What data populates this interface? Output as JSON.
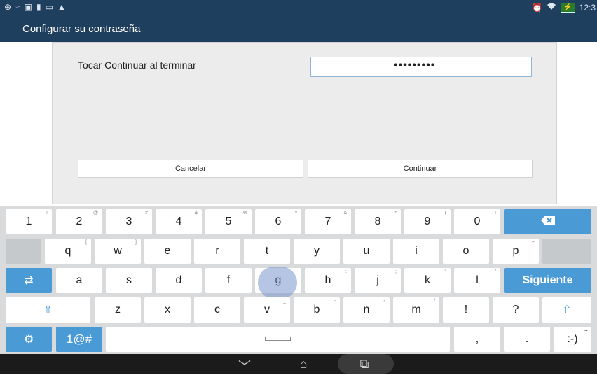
{
  "status_bar": {
    "left_icons": [
      "⊕",
      "≈",
      "▣",
      "▮",
      "▭",
      "▲"
    ],
    "right_icons": [
      "⏰",
      "wifi"
    ],
    "time": "12:3",
    "battery_label": "⚡"
  },
  "app": {
    "title": "Configurar su contraseña"
  },
  "form": {
    "prompt": "Tocar Continuar al terminar",
    "password_masked": "•••••••••",
    "cancel_label": "Cancelar",
    "continue_label": "Continuar"
  },
  "keyboard": {
    "row1": [
      {
        "label": "1",
        "hint": "!"
      },
      {
        "label": "2",
        "hint": "@"
      },
      {
        "label": "3",
        "hint": "#"
      },
      {
        "label": "4",
        "hint": "$"
      },
      {
        "label": "5",
        "hint": "%"
      },
      {
        "label": "6",
        "hint": "^"
      },
      {
        "label": "7",
        "hint": "&"
      },
      {
        "label": "8",
        "hint": "*"
      },
      {
        "label": "9",
        "hint": "("
      },
      {
        "label": "0",
        "hint": ")"
      }
    ],
    "backspace_icon": "backspace-icon",
    "row2": [
      {
        "label": "q",
        "hint": "["
      },
      {
        "label": "w",
        "hint": "]"
      },
      {
        "label": "e",
        "hint": ""
      },
      {
        "label": "r",
        "hint": ""
      },
      {
        "label": "t",
        "hint": ""
      },
      {
        "label": "y",
        "hint": ""
      },
      {
        "label": "u",
        "hint": ""
      },
      {
        "label": "i",
        "hint": ""
      },
      {
        "label": "o",
        "hint": ""
      },
      {
        "label": "p",
        "hint": "+"
      }
    ],
    "row3": [
      {
        "label": "a",
        "hint": ""
      },
      {
        "label": "s",
        "hint": ""
      },
      {
        "label": "d",
        "hint": ""
      },
      {
        "label": "f",
        "hint": ""
      },
      {
        "label": "g",
        "hint": ""
      },
      {
        "label": "h",
        "hint": ":"
      },
      {
        "label": "j",
        "hint": ";"
      },
      {
        "label": "k",
        "hint": "\""
      },
      {
        "label": "l",
        "hint": "'"
      }
    ],
    "siguiente_label": "Siguiente",
    "row4": [
      {
        "label": "z",
        "hint": ""
      },
      {
        "label": "x",
        "hint": ""
      },
      {
        "label": "c",
        "hint": ""
      },
      {
        "label": "v",
        "hint": "_"
      },
      {
        "label": "b",
        "hint": "-"
      },
      {
        "label": "n",
        "hint": "?"
      },
      {
        "label": "m",
        "hint": "/"
      },
      {
        "label": "!",
        "hint": ""
      },
      {
        "label": "?",
        "hint": ""
      }
    ],
    "shift_symbol": "⇧",
    "tab_symbol": "⇄",
    "settings_symbol": "⚙",
    "symbols_label": "1@#",
    "comma_label": ",",
    "period_label": ".",
    "emoticon_label": ":-)",
    "more_label": "..."
  },
  "navbar": {
    "back": "﹀",
    "home": "⌂",
    "recents": "⧉"
  },
  "colors": {
    "header": "#1f3f5f",
    "accent_key": "#4a9ad6",
    "keyboard_bg": "#d8dadc"
  }
}
